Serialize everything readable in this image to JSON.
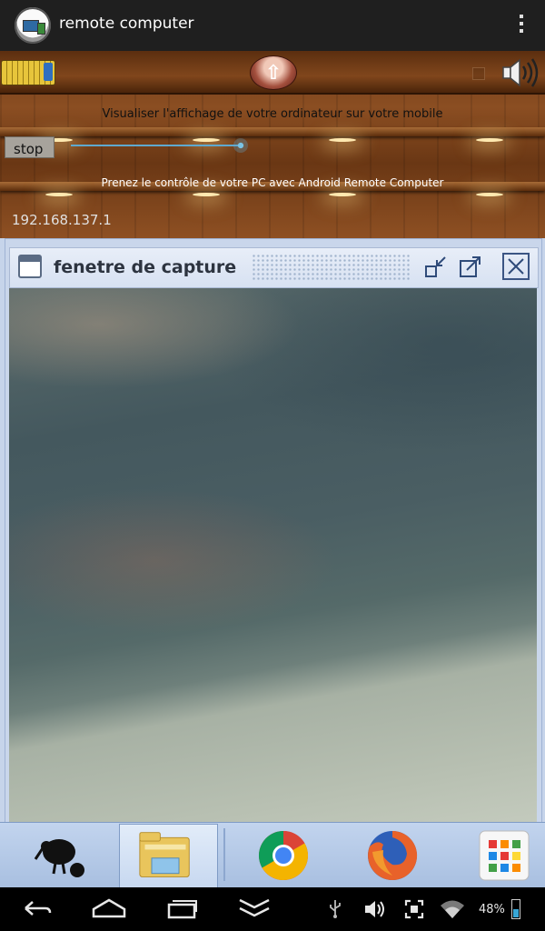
{
  "app_bar": {
    "title": "remote computer"
  },
  "controls": {
    "caption_top": "Visualiser l'affichage de votre ordinateur sur votre mobile",
    "stop_label": "stop",
    "slider_level": 0.9,
    "caption_bottom": "Prenez le contrôle de votre PC avec Android Remote Computer",
    "ip_address": "192.168.137.1"
  },
  "capture_window": {
    "title": "fenetre de capture"
  },
  "taskbar": {
    "items": [
      "kiwi-icon",
      "file-explorer-icon",
      "chrome-icon",
      "firefox-icon",
      "apps-grid-icon"
    ]
  },
  "status": {
    "battery": "48%"
  },
  "colors": {
    "wood": "#7a421a",
    "taskbar": "#b7cbe8",
    "accent_blue": "#5fa9cf"
  }
}
